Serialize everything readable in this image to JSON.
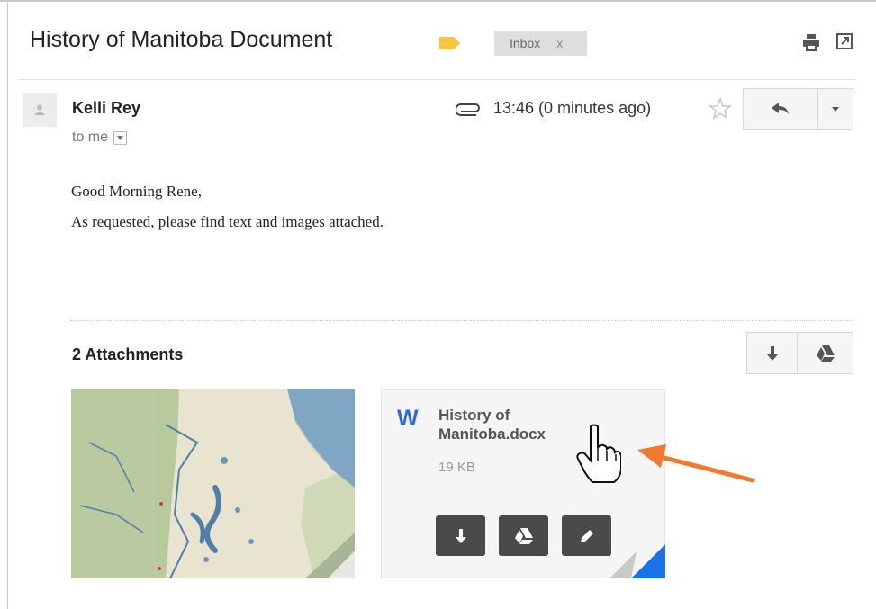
{
  "header": {
    "subject": "History of Manitoba Document",
    "label_color": "#f5c83c",
    "inbox_chip": {
      "label": "Inbox",
      "remove": "x"
    }
  },
  "message": {
    "sender": "Kelli Rey",
    "recipient": "to me",
    "timestamp": "13:46 (0 minutes ago)",
    "body_lines": [
      "Good Morning Rene,",
      "As requested, please find text and images attached."
    ]
  },
  "attachments": {
    "count_label": "2 Attachments",
    "items": [
      {
        "kind": "image",
        "icon": "map-image"
      },
      {
        "kind": "document",
        "icon": "word-icon",
        "icon_letter": "W",
        "name": "History of Manitoba.docx",
        "size": "19 KB"
      }
    ]
  },
  "icons": {
    "print": "print-icon",
    "new_window": "new-window-icon",
    "attachment": "paperclip-icon",
    "star": "star-icon",
    "reply": "reply-icon",
    "more": "chevron-down-icon",
    "download": "download-icon",
    "drive": "drive-icon",
    "edit": "pencil-icon",
    "cursor": "hand-cursor-icon"
  },
  "colors": {
    "arrow": "#f07b2f",
    "word_blue": "#2b6bd4",
    "button_dark": "#4a4a4a",
    "fold_blue": "#1a73e8"
  }
}
